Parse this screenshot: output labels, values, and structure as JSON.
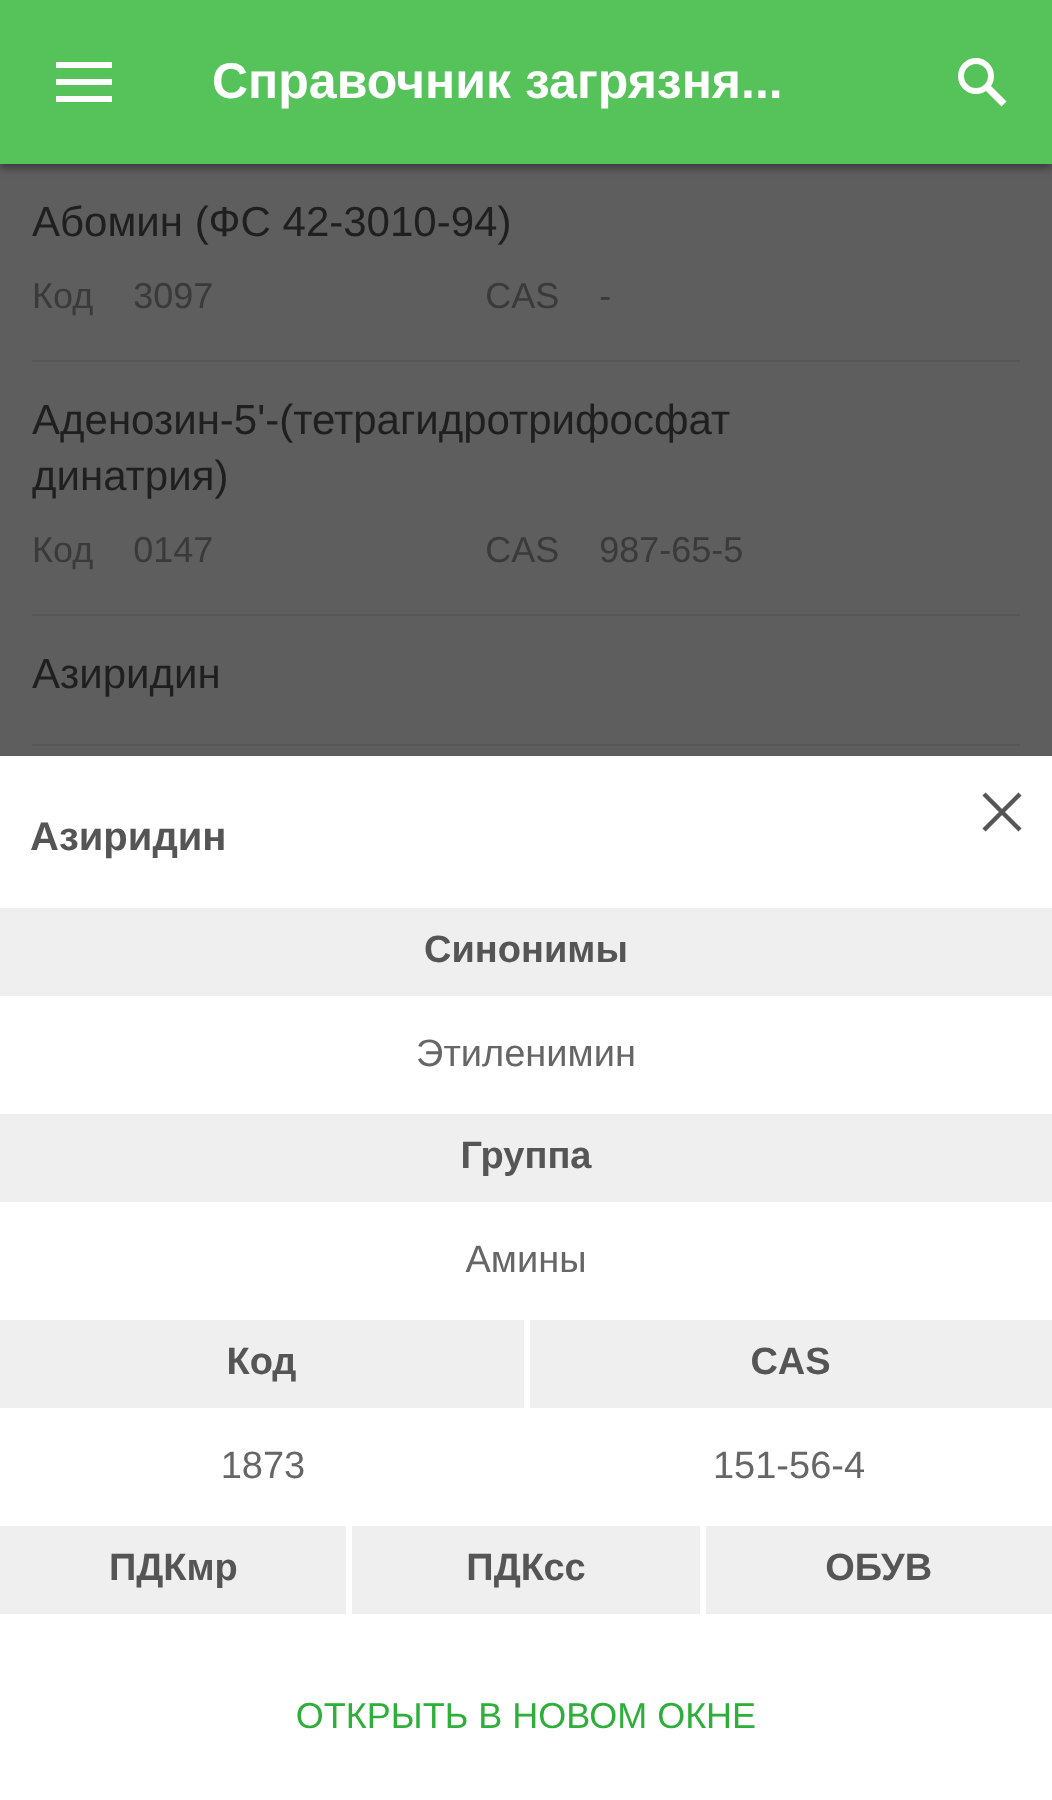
{
  "app_bar": {
    "title": "Справочник загрязня..."
  },
  "list": [
    {
      "name": "Абомин (ФС 42-3010-94)",
      "code_label": "Код",
      "code": "3097",
      "cas_label": "CAS",
      "cas": "-"
    },
    {
      "name": "Аденозин-5'-(тетрагидротрифосфат динатрия)",
      "code_label": "Код",
      "code": "0147",
      "cas_label": "CAS",
      "cas": "987-65-5"
    },
    {
      "name": "Азиридин"
    }
  ],
  "sheet": {
    "title": "Азиридин",
    "sections": [
      {
        "cells": [
          {
            "heading": "Синонимы",
            "value": "Этиленимин"
          }
        ]
      },
      {
        "cells": [
          {
            "heading": "Группа",
            "value": "Амины"
          }
        ]
      },
      {
        "cells": [
          {
            "heading": "Код",
            "value": "1873"
          },
          {
            "heading": "CAS",
            "value": "151-56-4"
          }
        ]
      },
      {
        "cells": [
          {
            "heading": "ПДКмр"
          },
          {
            "heading": "ПДКсс"
          },
          {
            "heading": "ОБУВ"
          }
        ]
      }
    ],
    "action": "ОТКРЫТЬ В НОВОМ ОКНЕ"
  }
}
